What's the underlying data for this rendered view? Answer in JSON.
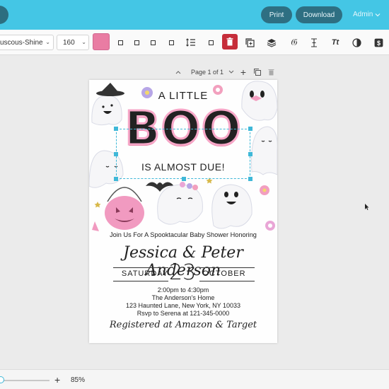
{
  "header": {
    "print_label": "Print",
    "download_label": "Download",
    "admin_label": "Admin"
  },
  "toolbar": {
    "font_family": "uscous-Shine",
    "font_size": "160",
    "text_color": "#e97ca3",
    "delete_color": "#c62d3a"
  },
  "page_nav": {
    "label": "Page 1 of 1"
  },
  "invitation": {
    "line1": "A LITTLE",
    "big": "BOO",
    "line3": "IS ALMOST DUE!",
    "honoring": "Join Us For A Spooktacular Baby Shower Honoring",
    "names": "Jessica & Peter Anderson",
    "day": "SATURDAY",
    "date": "23",
    "month": "OCTOBER",
    "time": "2:00pm to 4:30pm",
    "venue": "The Anderson's Home",
    "address": "123 Haunted Lane, New York, NY 10033",
    "rsvp": "Rsvp to Serena at 121-345-0000",
    "registry": "Registered at Amazon & Target"
  },
  "status": {
    "zoom": "85%"
  },
  "colors": {
    "accent": "#44c6e5",
    "button_dark": "#2e6f82",
    "boo_pink": "#f083ad",
    "selection": "#3fb8d8"
  }
}
